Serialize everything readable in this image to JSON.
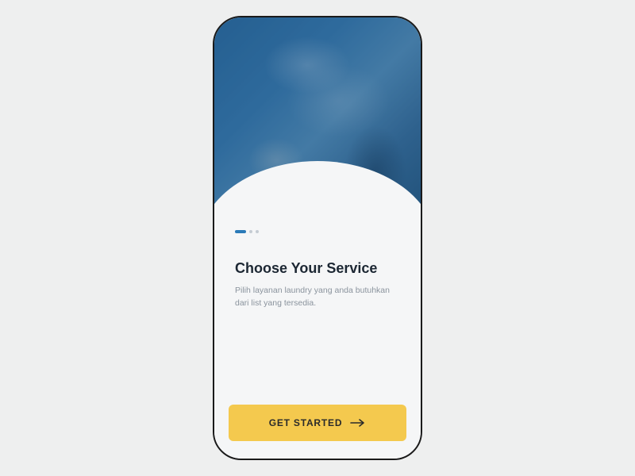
{
  "onboarding": {
    "title": "Choose Your Service",
    "subtitle": "Pilih layanan laundry yang anda butuhkan dari list yang tersedia.",
    "page_index": 0,
    "page_count": 3
  },
  "cta": {
    "label": "GET STARTED"
  },
  "colors": {
    "accent": "#2a7ab8",
    "cta_bg": "#f4c94e",
    "text_primary": "#1c2733",
    "text_muted": "#8a939d"
  }
}
